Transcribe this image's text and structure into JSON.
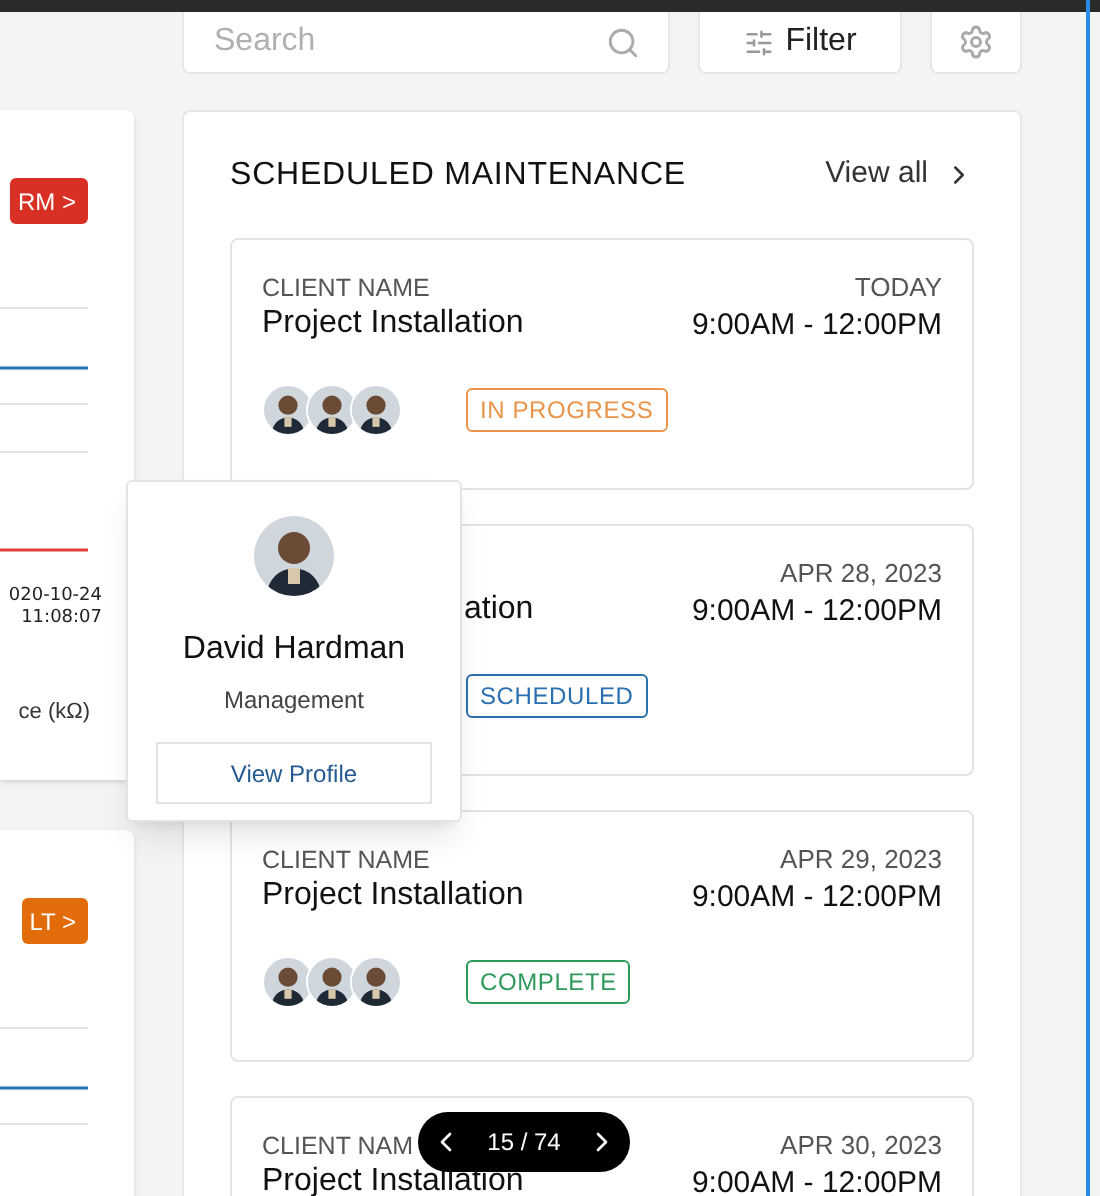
{
  "search": {
    "placeholder": "Search"
  },
  "filter_button": {
    "label": "Filter"
  },
  "side_panels": [
    {
      "button": "RM >",
      "color": "#d93025",
      "labels": [
        "020-10-24",
        "11:08:07"
      ],
      "axis_label": "ce (kΩ)"
    },
    {
      "button": "LT >",
      "color": "#e36c0a"
    }
  ],
  "maintenance": {
    "title": "SCHEDULED MAINTENANCE",
    "view_all": "View all",
    "items": [
      {
        "client": "CLIENT NAME",
        "title": "Project Installation",
        "date": "TODAY",
        "time": "9:00AM - 12:00PM",
        "status": "IN PROGRESS",
        "color": "#e8944a"
      },
      {
        "title": "ation",
        "date": "APR 28, 2023",
        "time": "9:00AM - 12:00PM",
        "status": "SCHEDULED",
        "color": "#2a6fb0",
        "partial": true
      },
      {
        "client": "CLIENT NAME",
        "title": "Project Installation",
        "date": "APR 29, 2023",
        "time": "9:00AM - 12:00PM",
        "status": "COMPLETE",
        "color": "#2e9a5a"
      },
      {
        "client": "CLIENT NAM",
        "title": "Project Installation",
        "date": "APR 30, 2023",
        "time": "9:00AM - 12:00PM"
      }
    ]
  },
  "profile_popover": {
    "name": "David Hardman",
    "role": "Management",
    "button": "View Profile"
  },
  "pager": {
    "label": "15 / 74"
  }
}
